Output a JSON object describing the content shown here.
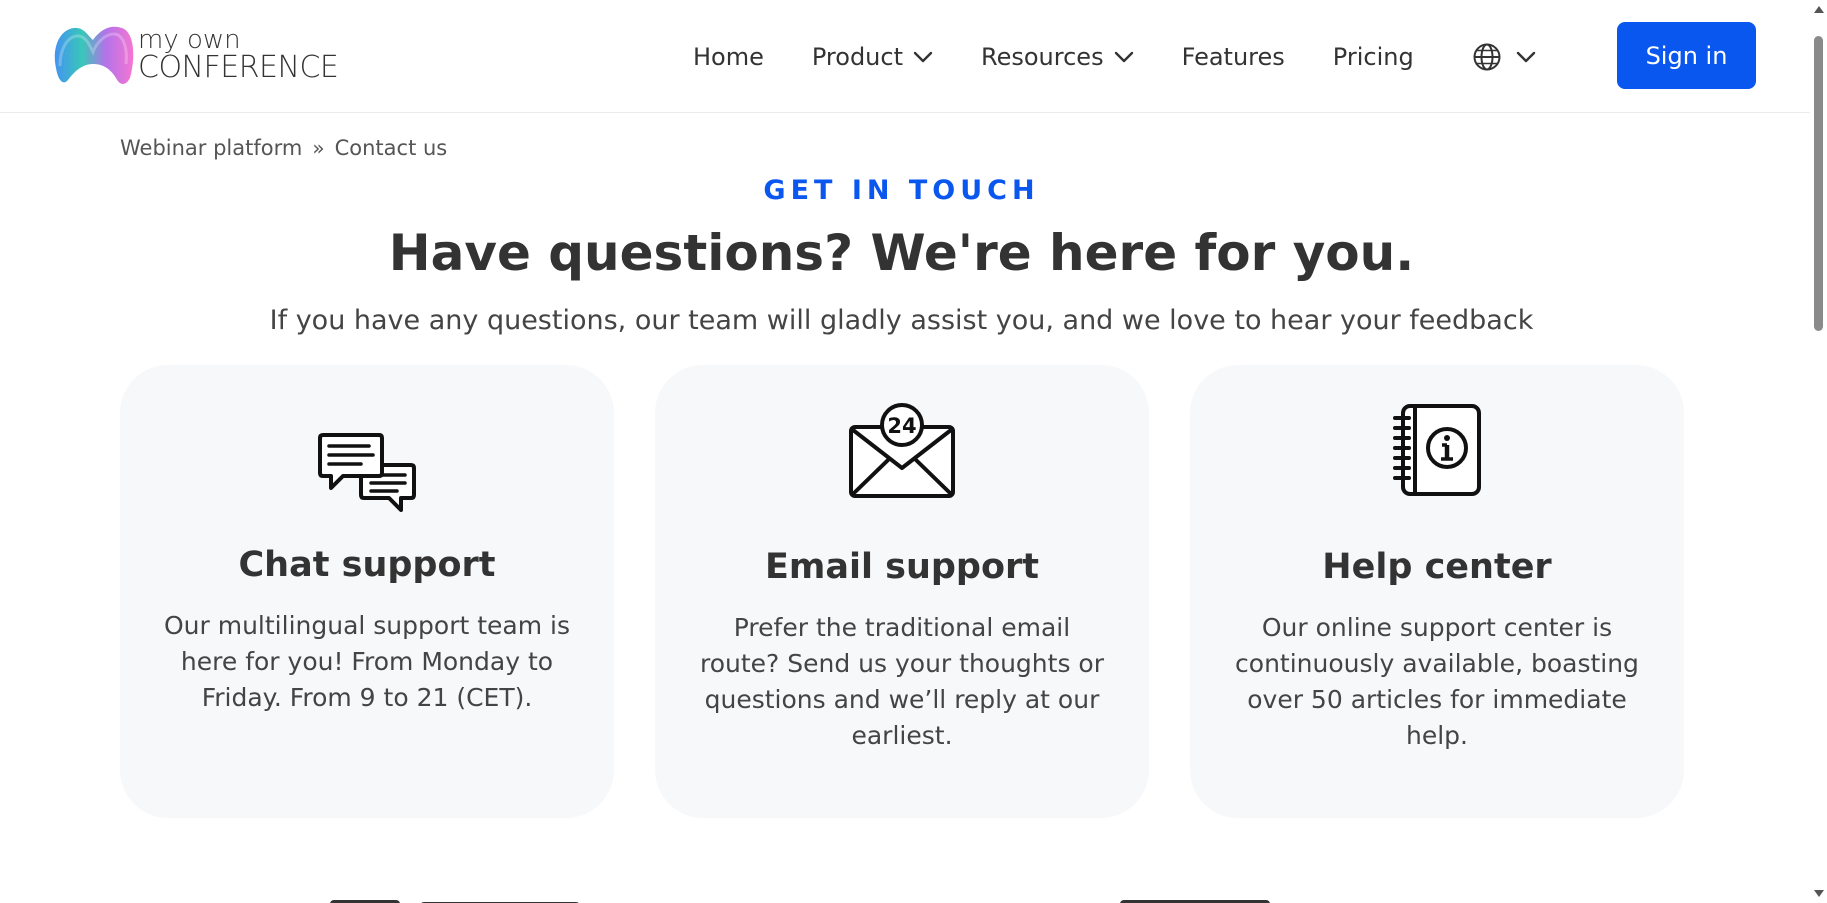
{
  "header": {
    "logo": {
      "line1": "my own",
      "line2": "CONFERENCE"
    },
    "nav": [
      {
        "label": "Home",
        "has_dropdown": false
      },
      {
        "label": "Product",
        "has_dropdown": true
      },
      {
        "label": "Resources",
        "has_dropdown": true
      },
      {
        "label": "Features",
        "has_dropdown": false
      },
      {
        "label": "Pricing",
        "has_dropdown": false
      }
    ],
    "language_icon": "globe-icon",
    "signin_label": "Sign in",
    "accent_color": "#0a57f0"
  },
  "breadcrumb": {
    "items": [
      "Webinar platform",
      "Contact us"
    ],
    "separator": "»"
  },
  "hero": {
    "eyebrow": "GET IN TOUCH",
    "title": "Have questions? We're here for you.",
    "subtitle": "If you have any questions, our team will gladly assist you, and we love to hear your feedback"
  },
  "cards": [
    {
      "icon": "chat-bubbles-icon",
      "title": "Chat support",
      "text": "Our multilingual support team is here for you! From Monday to Friday. From 9 to 21 (CET)."
    },
    {
      "icon": "email-24-icon",
      "icon_text": "24",
      "title": "Email support",
      "text": "Prefer the traditional email route? Send us your thoughts or questions and we’ll reply at our earliest."
    },
    {
      "icon": "info-notebook-icon",
      "title": "Help center",
      "text": "Our online support center is continuously available, boasting over 50 articles for immediate help."
    }
  ]
}
